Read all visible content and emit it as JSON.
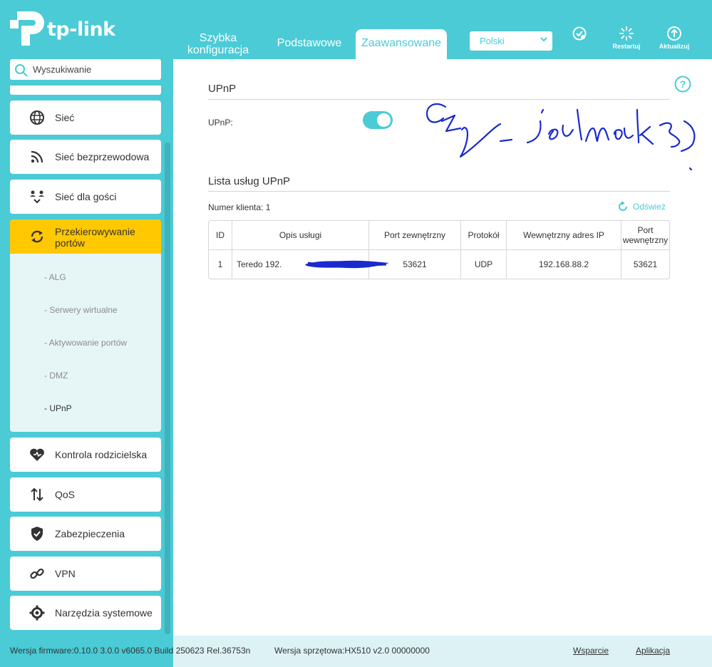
{
  "brand": {
    "name": "tp-link",
    "accent": "#4acbd6",
    "highlight": "#ffc800"
  },
  "header": {
    "tabs": [
      {
        "label_line1": "Szybka",
        "label_line2": "konfiguracja"
      },
      {
        "label": "Podstawowe"
      },
      {
        "label": "Zaawansowane",
        "active": true
      }
    ],
    "language": "Polski",
    "actions": [
      {
        "label": "",
        "icon": "cloud-update-icon"
      },
      {
        "label": "Restartuj",
        "icon": "restart-icon"
      },
      {
        "label": "Aktualizuj",
        "icon": "upload-icon"
      }
    ]
  },
  "sidebar": {
    "search_placeholder": "Wyszukiwanie",
    "items": [
      {
        "label": "Sieć",
        "icon": "globe-icon"
      },
      {
        "label": "Sieć bezprzewodowa",
        "icon": "wireless-icon"
      },
      {
        "label": "Sieć dla gości",
        "icon": "guest-network-icon"
      },
      {
        "label": "Przekierowywanie portów",
        "icon": "port-forwarding-icon",
        "active": true
      },
      {
        "label": "Kontrola rodzicielska",
        "icon": "parental-control-icon"
      },
      {
        "label": "QoS",
        "icon": "qos-icon"
      },
      {
        "label": "Zabezpieczenia",
        "icon": "shield-icon"
      },
      {
        "label": "VPN",
        "icon": "vpn-icon"
      },
      {
        "label": "Narzędzia systemowe",
        "icon": "gear-icon"
      }
    ],
    "subitems": [
      "- ALG",
      "- Serwery wirtualne",
      "- Aktywowanie portów",
      "- DMZ",
      "- UPnP"
    ],
    "active_subitem": "- UPnP"
  },
  "main": {
    "section_upnp": "UPnP",
    "upnp_label": "UPnP:",
    "upnp_enabled": true,
    "section_list": "Lista usług UPnP",
    "client_label": "Numer klienta:",
    "client_count": "1",
    "refresh_label": "Odśwież",
    "table": {
      "headers": [
        "ID",
        "Opis usługi",
        "Port zewnętrzny",
        "Protokół",
        "Wewnętrzny adres IP",
        "Port wewnętrzny"
      ],
      "rows": [
        [
          "1",
          "Teredo 192.",
          "53621",
          "UDP",
          "192.168.88.2",
          "53621"
        ]
      ]
    }
  },
  "footer": {
    "firmware": "Wersja firmware:0.10.0 3.0.0 v6065.0 Build 250623 Rel.36753n",
    "hardware": "Wersja sprzętowa:HX510 v2.0 00000000",
    "support": "Wsparcie",
    "app": "Aplikacja"
  }
}
